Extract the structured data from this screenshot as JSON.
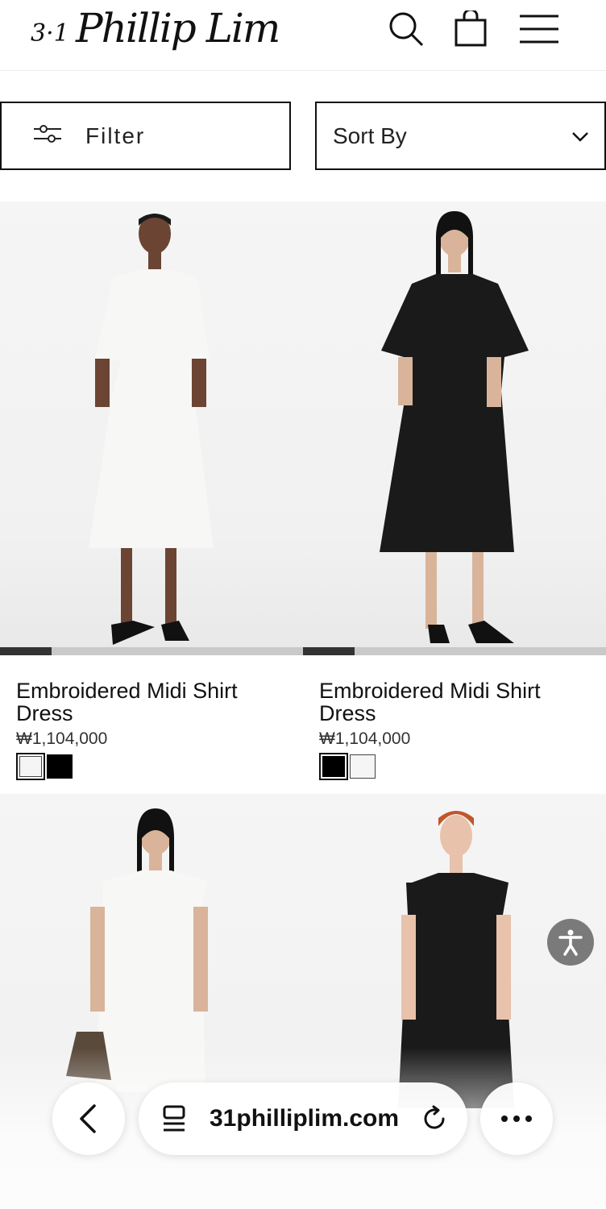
{
  "header": {
    "logo_number": "3·1",
    "logo_script": "Phillip Lim",
    "icons": [
      "search-icon",
      "shopping-bag-icon",
      "hamburger-menu-icon"
    ]
  },
  "toolbar": {
    "filter_label": "Filter",
    "sort_label": "Sort By"
  },
  "products": [
    {
      "name": "Embroidered Midi Shirt Dress",
      "price": "₩1,104,000",
      "dress_color": "#f7f7f5",
      "carousel_progress": 0.17,
      "swatches": [
        {
          "color": "white",
          "selected": true
        },
        {
          "color": "black",
          "selected": false
        }
      ]
    },
    {
      "name": "Embroidered Midi Shirt Dress",
      "price": "₩1,104,000",
      "dress_color": "#1a1a1a",
      "carousel_progress": 0.17,
      "swatches": [
        {
          "color": "black",
          "selected": true
        },
        {
          "color": "white",
          "selected": false
        }
      ]
    },
    {
      "name": "",
      "price": "",
      "dress_color": "#f7f7f5",
      "swatches": []
    },
    {
      "name": "",
      "price": "",
      "dress_color": "#1a1a1a",
      "swatches": []
    }
  ],
  "browser": {
    "url": "31philliplim.com",
    "icons": [
      "back-chevron-icon",
      "page-tabs-icon",
      "reload-icon",
      "more-options-icon"
    ]
  },
  "colors": {
    "accessibility_button": "#7a7a7a",
    "border": "#111111"
  }
}
